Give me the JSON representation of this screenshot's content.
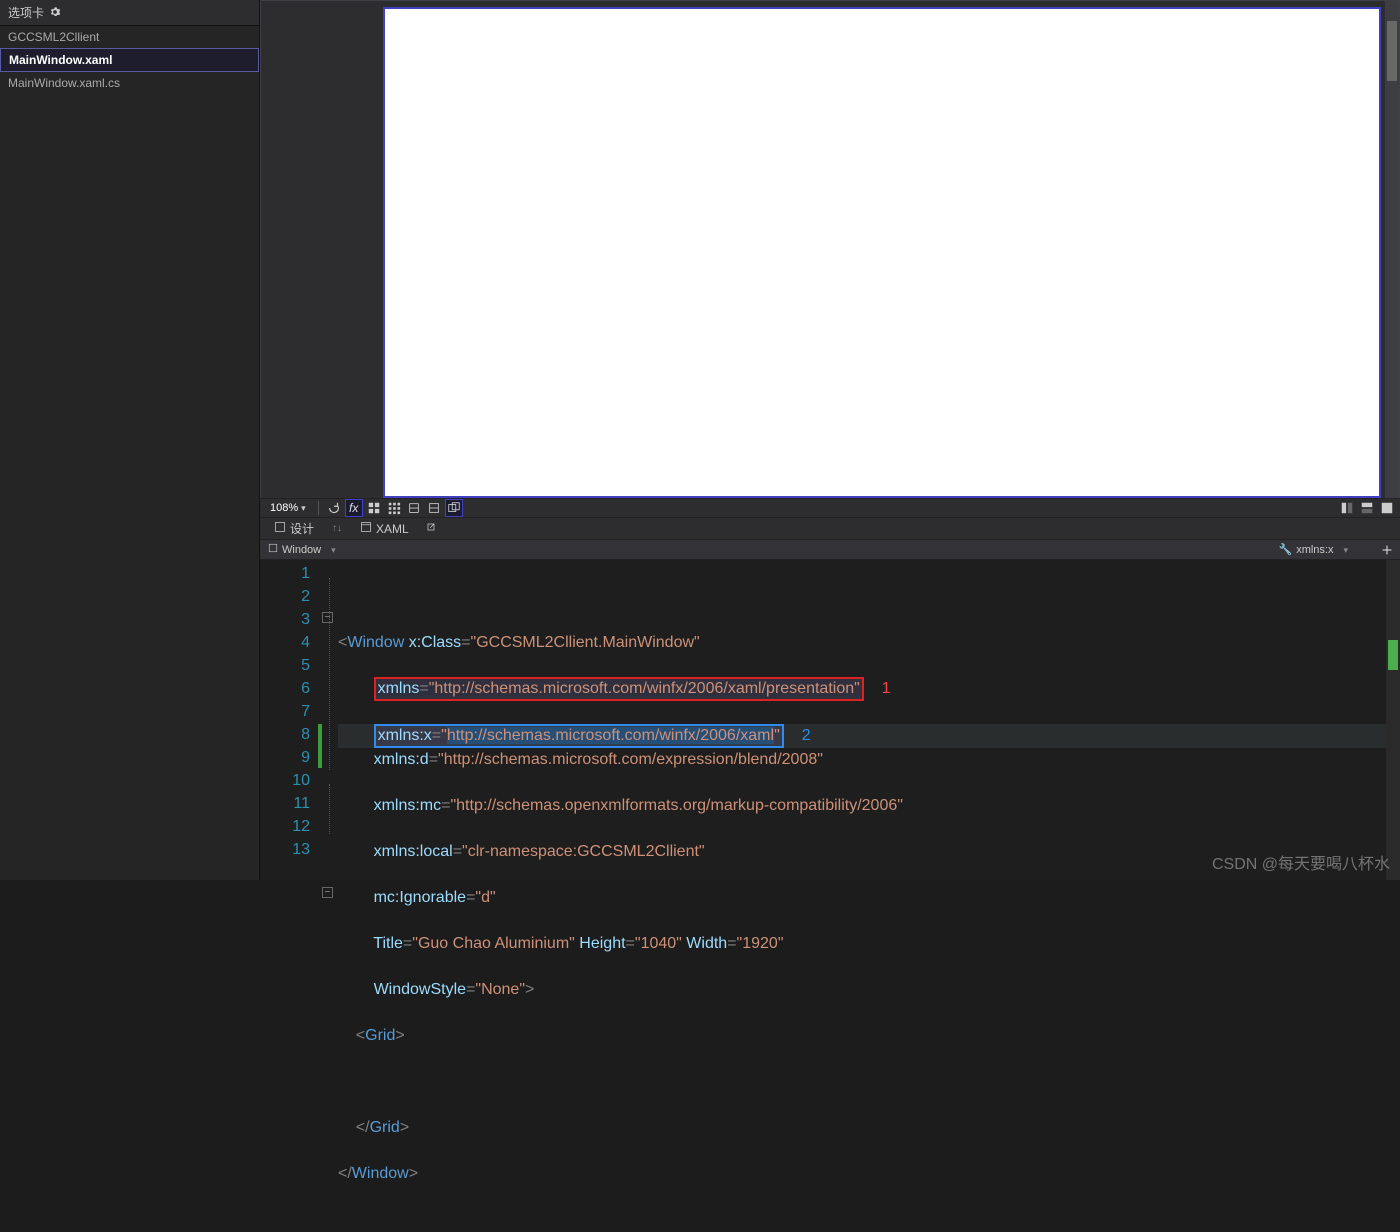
{
  "sidebar": {
    "header": "选项卡",
    "items": [
      {
        "label": "GCCSML2Cllient",
        "active": false
      },
      {
        "label": "MainWindow.xaml",
        "active": true
      },
      {
        "label": "MainWindow.xaml.cs",
        "active": false
      }
    ]
  },
  "toolbar": {
    "zoom": "108%",
    "design_tab": "设计",
    "xaml_tab": "XAML"
  },
  "breadcrumb": {
    "left": "Window",
    "right": "xmlns:x"
  },
  "annotations": {
    "red": "1",
    "blue": "2"
  },
  "code": {
    "lines": [
      1,
      2,
      3,
      4,
      5,
      6,
      7,
      8,
      9,
      10,
      11,
      12,
      13
    ],
    "window_el": "Window",
    "class_attr": "x:Class",
    "class_val": "GCCSML2Cllient.MainWindow",
    "xmlns_attr": "xmlns",
    "xmlns_val": "http://schemas.microsoft.com/winfx/2006/xaml/presentation",
    "xmlns_x_attr": "xmlns:x",
    "xmlns_x_val": "http://schemas.microsoft.com/winfx/2006/xaml",
    "xmlns_d_attr": "xmlns:d",
    "xmlns_d_val": "http://schemas.microsoft.com/expression/blend/2008",
    "xmlns_mc_attr": "xmlns:mc",
    "xmlns_mc_val": "http://schemas.openxmlformats.org/markup-compatibility/2006",
    "xmlns_local_attr": "xmlns:local",
    "xmlns_local_val": "clr-namespace:GCCSML2Cllient",
    "ignorable_attr": "mc:Ignorable",
    "ignorable_val": "d",
    "title_attr": "Title",
    "title_val": "Guo Chao Aluminium",
    "height_attr": "Height",
    "height_val": "1040",
    "width_attr": "Width",
    "width_val": "1920",
    "winstyle_attr": "WindowStyle",
    "winstyle_val": "None",
    "grid_el": "Grid"
  },
  "watermark": "CSDN @每天要喝八杯水"
}
